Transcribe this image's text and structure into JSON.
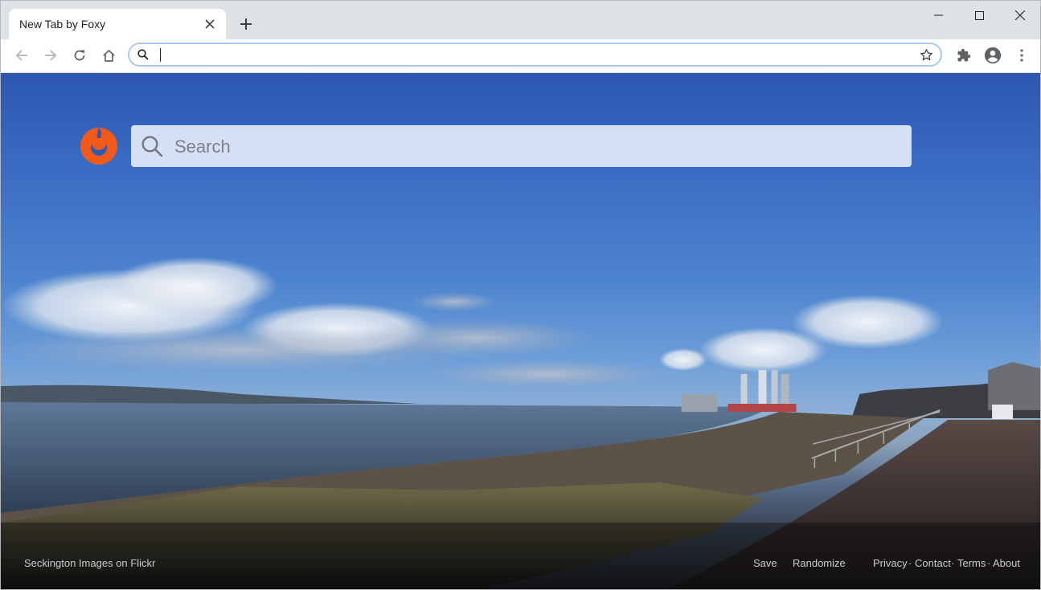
{
  "tab": {
    "title": "New Tab by Foxy"
  },
  "address_bar": {
    "value": "",
    "placeholder": ""
  },
  "page": {
    "search_placeholder": "Search",
    "photo_credit": "Seckington Images on Flickr",
    "actions": {
      "save": "Save",
      "randomize": "Randomize"
    },
    "links": {
      "privacy": "Privacy",
      "contact": "Contact",
      "terms": "Terms",
      "about": "About"
    },
    "link_separator": "·"
  },
  "colors": {
    "accent": "#1a73e8",
    "foxy_orange": "#f25a1c",
    "sky_top": "#2d57b0",
    "footer_text": "#c9ccd2"
  },
  "icons": {
    "back": "arrow-left-icon",
    "forward": "arrow-right-icon",
    "reload": "reload-icon",
    "home": "home-icon",
    "search": "search-icon",
    "bookmark": "star-icon",
    "extensions": "puzzle-icon",
    "profile": "account-icon",
    "menu": "kebab-menu-icon"
  }
}
